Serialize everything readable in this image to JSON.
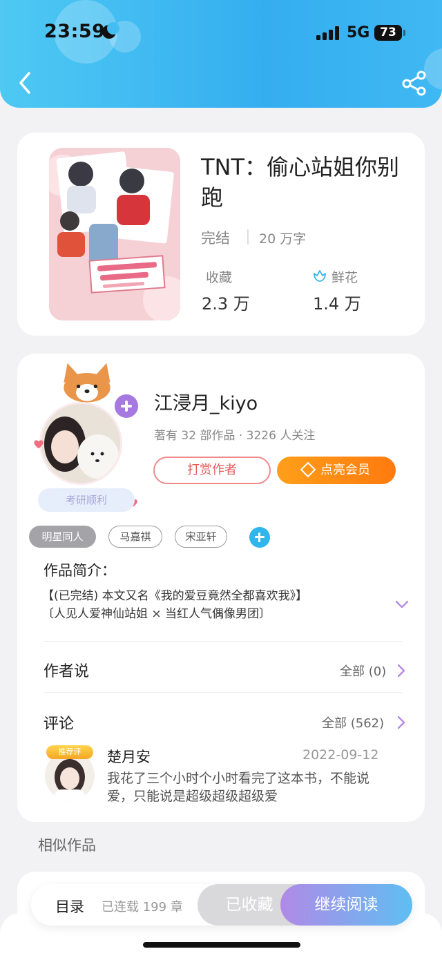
{
  "status_bar": {
    "time": "23:59",
    "network": "5G",
    "battery": "73"
  },
  "book": {
    "title": "TNT：偷心站姐你别跑",
    "status": "完结",
    "word_count": "20 万字",
    "favorites_label": "收藏",
    "favorites_value": "2.3 万",
    "flowers_label": "鲜花",
    "flowers_value": "1.4 万"
  },
  "author": {
    "name": "江浸月_kiyo",
    "meta": "著有 32 部作品 · 3226 人关注",
    "pendant_label": "考研顺利",
    "tip_button": "打赏作者",
    "vip_button": "点亮会员"
  },
  "tags": {
    "category": "明星同人",
    "items": [
      "马嘉祺",
      "宋亚轩"
    ]
  },
  "synopsis": {
    "title": "作品简介：",
    "line1": "【(已完结) 本文又名《我的爱豆竟然全都喜欢我》】",
    "line2": "〔人见人爱神仙站姐 × 当红人气偶像男团〕"
  },
  "author_says": {
    "title": "作者说",
    "all_link": "全部 (0)"
  },
  "comments": {
    "title": "评论",
    "all_link": "全部 (562)",
    "featured": {
      "badge": "推荐评",
      "name": "楚月安",
      "date": "2022-09-12",
      "text": "我花了三个小时个小时看完了这本书，不能说爱，只能说是超级超级超级爱"
    }
  },
  "similar": {
    "title": "相似作品"
  },
  "bottom": {
    "toc": "目录",
    "serial": "已连载 199 章",
    "collected": "已收藏",
    "continue": "继续阅读"
  },
  "colors": {
    "header_start": "#4ec9f3",
    "header_end": "#35aef0",
    "vip_orange": "#ff8a14",
    "tip_red": "#e25d5d",
    "read_gradient_start": "#b08ae6",
    "read_gradient_end": "#5fbef3"
  }
}
